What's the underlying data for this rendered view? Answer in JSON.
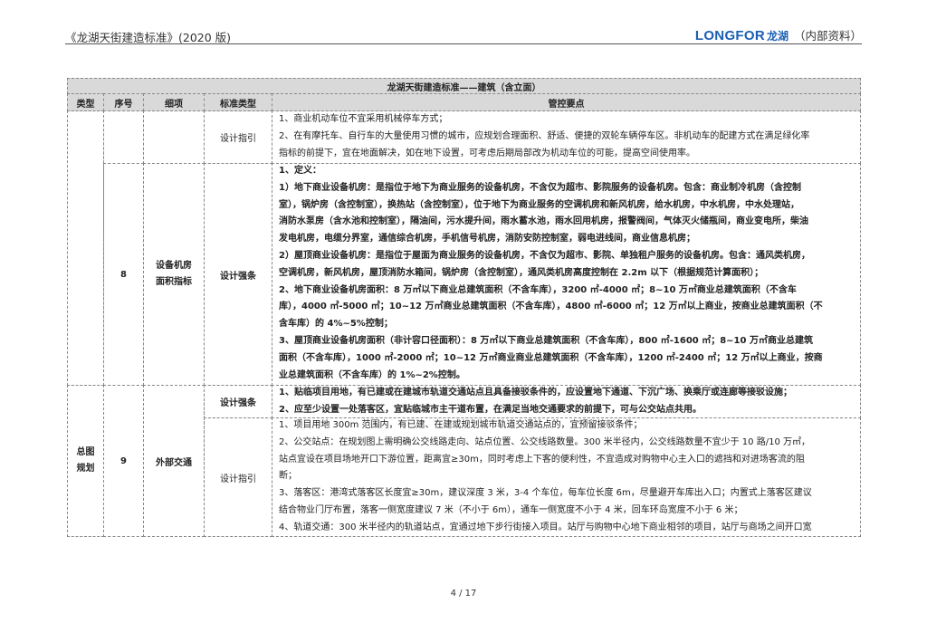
{
  "header": {
    "doc_title": "《龙湖天街建造标准》(2020 版)",
    "logo_text": "LONGFOR",
    "logo_cn": "龙湖",
    "classification": "（内部资料）"
  },
  "table": {
    "title": "龙湖天街建造标准——建筑（含立面）",
    "columns": [
      "类型",
      "序号",
      "细项",
      "标准类型",
      "管控要点"
    ],
    "rows": [
      {
        "type": "",
        "no": "",
        "item": "",
        "std": "设计指引",
        "lines": [
          "1、商业机动车位不宜采用机械停车方式；",
          "2、在有摩托车、自行车的大量使用习惯的城市，应规划合理面积、舒适、便捷的双轮车辆停车区。非机动车的配建方式在满足绿化率",
          "指标的前提下，宜在地面解决，如在地下设置，可考虑后期局部改为机动车位的可能，提高空间使用率。"
        ]
      },
      {
        "type": "",
        "no": "8",
        "item": "设备机房面积指标",
        "std": "设计强条",
        "lines": [
          "1、定义：",
          "1）地下商业设备机房：是指位于地下为商业服务的设备机房，不含仅为超市、影院服务的设备机房。包含：商业制冷机房（含控制",
          "室），锅炉房（含控制室），换热站（含控制室），位于地下为商业服务的空调机房和新风机房，给水机房，中水机房，中水处理站，",
          "消防水泵房（含水池和控制室），隔油间，污水提升间，雨水蓄水池，雨水回用机房，报警阀间，气体灭火储瓶间，商业变电所，柴油",
          "发电机房，电缆分界室，通信综合机房，手机信号机房，消防安防控制室，弱电进线间，商业信息机房；",
          "2）屋顶商业设备机房：是指位于屋面为商业服务的设备机房，不含仅为超市、影院、单独租户服务的设备机房。包含：通风类机房，",
          "空调机房，新风机房，屋顶消防水箱间，锅炉房（含控制室），通风类机房高度控制在 2.2m 以下（根据规范计算面积）；",
          "2、地下商业设备机房面积：8 万㎡以下商业总建筑面积（不含车库），3200 ㎡-4000 ㎡；8~10 万㎡商业总建筑面积（不含车",
          "库），4000 ㎡-5000 ㎡；10~12 万㎡商业总建筑面积（不含车库），4800 ㎡-6000 ㎡；12 万㎡以上商业，按商业总建筑面积（不",
          "含车库）的 4%~5%控制；",
          "3、屋顶商业设备机房面积（非计容口径面积）：8 万㎡以下商业总建筑面积（不含车库），800 ㎡-1600 ㎡；8~10 万㎡商业总建筑",
          "面积（不含车库），1000 ㎡-2000 ㎡；10~12 万㎡商业商业总建筑面积（不含车库），1200 ㎡-2400 ㎡；12 万㎡以上商业，按商",
          "业总建筑面积（不含车库）的 1%~2%控制。"
        ]
      },
      {
        "type": "总图规划",
        "no": "9",
        "item": "外部交通",
        "sub": [
          {
            "std": "设计强条",
            "lines": [
              "1、贴临项目用地，有已建或在建城市轨道交通站点且具备接驳条件的，应设置地下通道、下沉广场、换乘厅或连廊等接驳设施；",
              "2、应至少设置一处落客区，宜贴临城市主干道布置，在满足当地交通要求的前提下，可与公交站点共用。"
            ]
          },
          {
            "std": "设计指引",
            "lines": [
              "1、项目用地 300m 范围内，有已建、在建或规划城市轨道交通站点的，宜预留接驳条件；",
              "2、公交站点：在规划图上需明确公交线路走向、站点位置、公交线路数量。300 米半径内，公交线路数量不宜少于 10 路/10 万㎡，",
              "站点宜设在项目场地开口下游位置，距离宜≥30m，同时考虑上下客的便利性，不宜造成对购物中心主入口的遮挡和对进场客流的阻",
              "断；",
              "3、落客区：港湾式落客区长度宜≥30m，建议深度 3 米，3-4 个车位，每车位长度 6m，尽量避开车库出入口；内置式上落客区建议",
              "结合物业门厅布置，落客一侧宽度建议 7 米（不小于 6m），通车一侧宽度不小于 4 米，回车环岛宽度不小于 6 米；",
              "4、轨道交通：300 米半径内的轨道站点，宜通过地下步行街接入项目。站厅与购物中心地下商业相邻的项目，站厅与商场之间开口宽"
            ]
          }
        ]
      }
    ]
  },
  "footer": {
    "page": "4 / 17"
  },
  "colors": {
    "brand": "#1a5fb4",
    "header_fill": "#d9d9d9"
  }
}
